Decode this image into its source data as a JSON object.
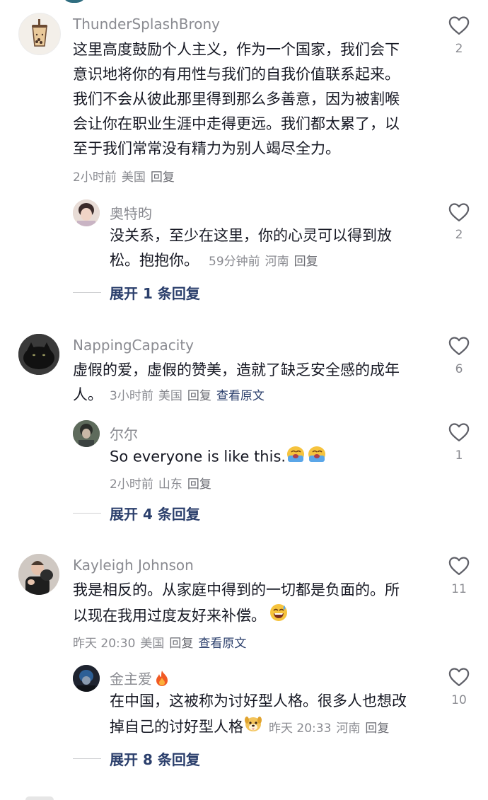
{
  "colors": {
    "text": "#161823",
    "meta": "#8a8b91",
    "link": "#2b3f6c",
    "heart_outline": "#5f6068"
  },
  "comments": [
    {
      "username": "ThunderSplashBrony",
      "avatar": "bubble-tea-avatar",
      "text_lines": [
        "这里高度鼓励个人主义，作为一个国家，我们会下",
        "意识地将你的有用性与我们的自我价值联系起来。",
        "我们不会从彼此那里得到那么多善意，因为被割喉",
        "会让你在职业生涯中走得更远。我们都太累了，以",
        "至于我们常常没有精力为别人竭尽全力。"
      ],
      "time": "2小时前",
      "location": "美国",
      "reply_label": "回复",
      "likes": "2",
      "replies": [
        {
          "username": "奥特昀",
          "text_lines": [
            "没关系，至少在这里，你的心灵可以得到放",
            "松。抱抱你。"
          ],
          "time": "59分钟前",
          "location": "河南",
          "reply_label": "回复",
          "likes": "2"
        }
      ],
      "expand_label": "展开 1 条回复"
    },
    {
      "username": "NappingCapacity",
      "avatar": "black-cat-avatar",
      "text_lines": [
        "虚假的爱，虚假的赞美，造就了缺乏安全感的成年",
        "人。"
      ],
      "time": "3小时前",
      "location": "美国",
      "reply_label": "回复",
      "translate_label": "查看原文",
      "likes": "6",
      "replies": [
        {
          "username": "尔尔",
          "text_lines": [
            "So everyone is like this."
          ],
          "emoji": "crying-face-emoji ×2",
          "time": "2小时前",
          "location": "山东",
          "reply_label": "回复",
          "likes": "1"
        }
      ],
      "expand_label": "展开 4 条回复"
    },
    {
      "username": "Kayleigh Johnson",
      "avatar": "person-with-cat-avatar",
      "text_lines": [
        "我是相反的。从家庭中得到的一切都是负面的。所",
        "以现在我用过度友好来补偿。"
      ],
      "emoji": "sweat-smile-emoji",
      "time": "昨天 20:30",
      "location": "美国",
      "reply_label": "回复",
      "translate_label": "查看原文",
      "likes": "11",
      "replies": [
        {
          "username": "金主爱",
          "username_emoji": "fire-emoji",
          "text_lines": [
            "在中国，这被称为讨好型人格。很多人也想改",
            "掉自己的讨好型人格"
          ],
          "emoji": "dog-face-emoji",
          "time": "昨天 20:33",
          "location": "河南",
          "reply_label": "回复",
          "likes": "10"
        }
      ],
      "expand_label": "展开 8 条回复"
    }
  ]
}
